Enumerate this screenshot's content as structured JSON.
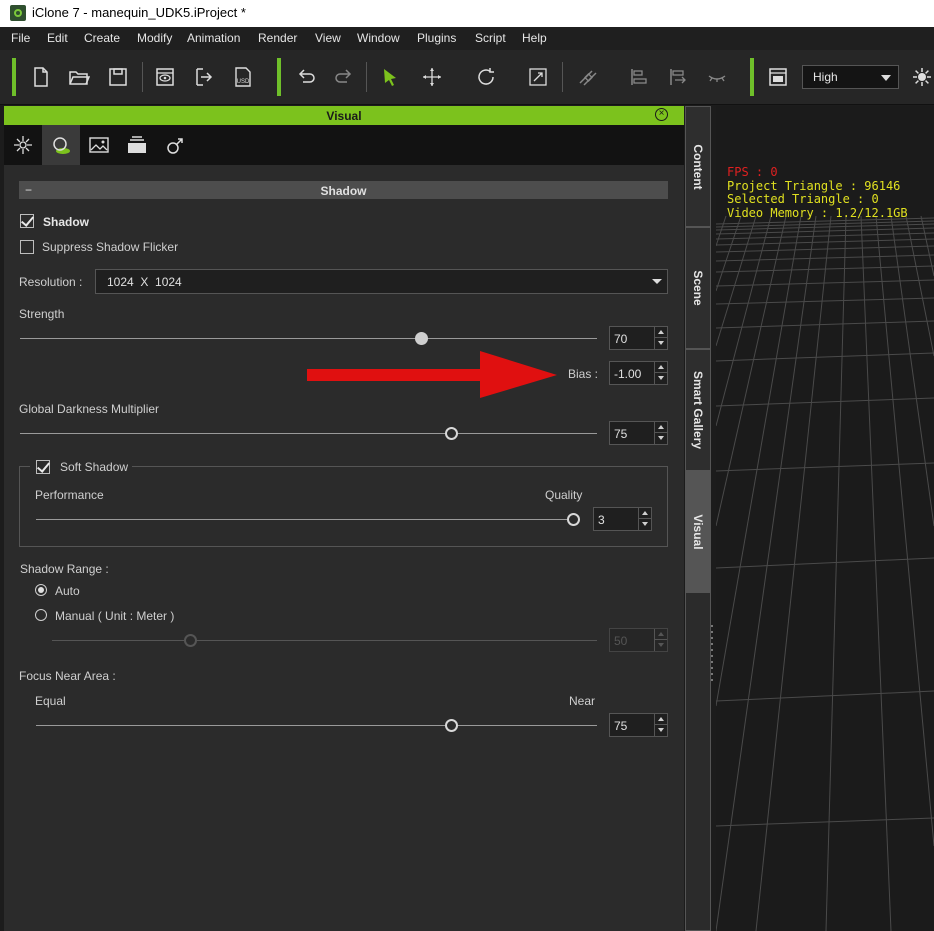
{
  "window": {
    "title": "iClone 7 - manequin_UDK5.iProject *"
  },
  "menu": [
    "File",
    "Edit",
    "Create",
    "Modify",
    "Animation",
    "Render",
    "View",
    "Window",
    "Plugins",
    "Script",
    "Help"
  ],
  "toolbar": {
    "icons": [
      "new-file-icon",
      "open-folder-icon",
      "save-icon",
      "preview-icon",
      "export-icon",
      "usd-export-icon",
      "undo-icon",
      "redo-icon",
      "select-arrow-icon",
      "move-icon",
      "rotate-icon",
      "scale-icon",
      "align-icon",
      "align-left-icon",
      "align-distribute-icon",
      "eye-closed-icon",
      "layout-icon",
      "sun-icon"
    ],
    "usd_label": "USD",
    "quality": "High"
  },
  "panel": {
    "title": "Visual",
    "tabs": [
      "atmosphere-tab-icon",
      "shadow-tab-icon",
      "image-tab-icon",
      "layers-tab-icon",
      "gender-tab-icon"
    ],
    "section_title": "Shadow",
    "collapse_symbol": "−",
    "shadow": {
      "label": "Shadow",
      "checked": true
    },
    "suppress_flicker": {
      "label": "Suppress Shadow Flicker",
      "checked": false
    },
    "resolution": {
      "label": "Resolution :",
      "value": "1024  X  1024"
    },
    "strength": {
      "label": "Strength",
      "value": "70"
    },
    "bias": {
      "label": "Bias :",
      "value": "-1.00"
    },
    "darkness": {
      "label": "Global Darkness Multiplier",
      "value": "75"
    },
    "soft_shadow": {
      "label": "Soft Shadow",
      "checked": true,
      "left_label": "Performance",
      "right_label": "Quality",
      "value": "3"
    },
    "shadow_range": {
      "label": "Shadow Range :",
      "auto_label": "Auto",
      "manual_label": "Manual ( Unit : Meter )",
      "selected": "Auto",
      "manual_value": "50"
    },
    "focus": {
      "label": "Focus Near Area :",
      "left_label": "Equal",
      "right_label": "Near",
      "value": "75"
    }
  },
  "side_tabs": [
    "Content",
    "Scene",
    "Smart Gallery",
    "Visual"
  ],
  "side_tab_active": "Visual",
  "viewport": {
    "fps": "FPS : 0",
    "project_triangle": "Project Triangle : 96146",
    "selected_triangle": "Selected Triangle : 0",
    "video_memory": "Video Memory : 1.2/12.1GB"
  },
  "colors": {
    "accent": "#7cc21d",
    "arrow": "#e01010",
    "fps": "#e02020",
    "stats": "#e0e020"
  }
}
